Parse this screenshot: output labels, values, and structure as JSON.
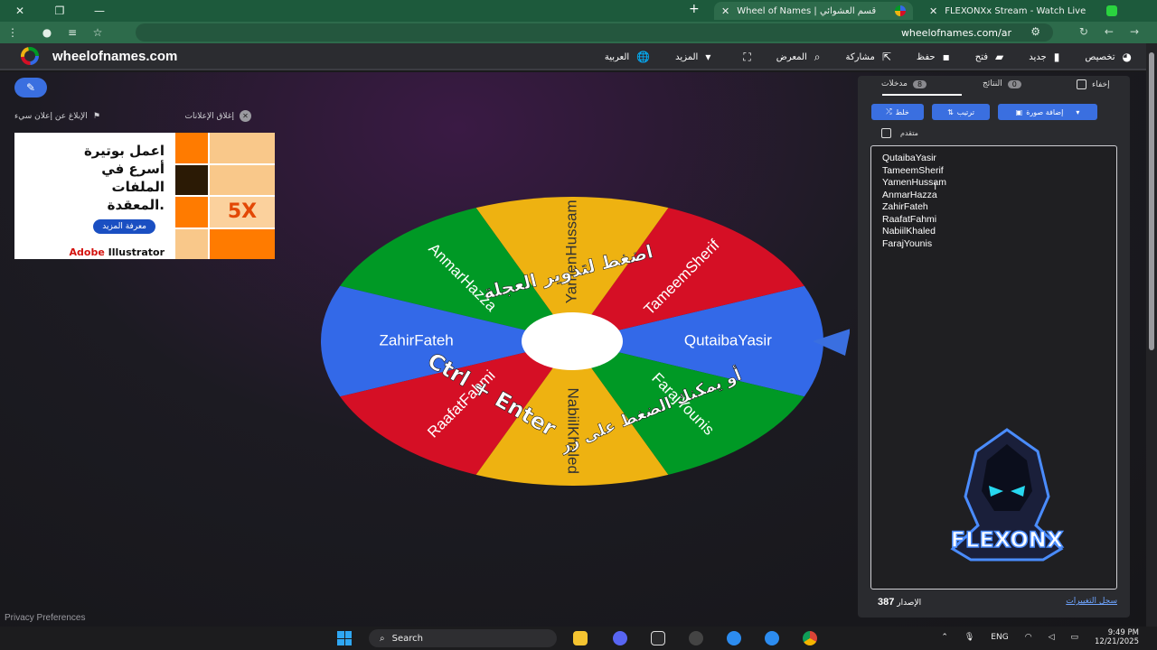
{
  "browser": {
    "tabs": [
      {
        "title": "Wheel of Names | قسم العشوائي",
        "active": true
      },
      {
        "title": "FLEXONXx Stream - Watch Live",
        "active": false
      }
    ],
    "new_tab": "+",
    "url": "wheelofnames.com/ar"
  },
  "header": {
    "logo_text": "wheelofnames.com",
    "menu": [
      {
        "label": "العربية",
        "icon": "globe-icon"
      },
      {
        "label": "المزيد",
        "icon": "dropdown-icon"
      },
      {
        "label": "",
        "icon": "fullscreen-icon"
      },
      {
        "label": "المعرض",
        "icon": "search-icon"
      },
      {
        "label": "مشاركة",
        "icon": "share-icon"
      },
      {
        "label": "حفظ",
        "icon": "save-icon"
      },
      {
        "label": "فتح",
        "icon": "folder-icon"
      },
      {
        "label": "جديد",
        "icon": "file-icon"
      },
      {
        "label": "تخصيص",
        "icon": "palette-icon"
      }
    ]
  },
  "ads": {
    "close_ads": "إغلاق الإعلانات",
    "report_ad": "الإبلاغ عن إعلان سيء",
    "title_lines": [
      "اعمل بوتيرة",
      "أسرع في",
      "الملفات",
      "المعقدة."
    ],
    "cta": "معرفة المزيد",
    "brand_a": "Adobe",
    "brand_b": "Illustrator",
    "badge": "5X"
  },
  "wheel": {
    "segments": [
      {
        "name": "QutaibaYasir",
        "color": "#3369e8"
      },
      {
        "name": "TameemSherif",
        "color": "#d50f25"
      },
      {
        "name": "YamenHussam",
        "color": "#eeb211"
      },
      {
        "name": "AnmarHazza",
        "color": "#009925"
      },
      {
        "name": "ZahirFateh",
        "color": "#3369e8"
      },
      {
        "name": "RaafatFahmi",
        "color": "#d50f25"
      },
      {
        "name": "NabiilKhaled",
        "color": "#eeb211"
      },
      {
        "name": "FarajYounis",
        "color": "#009925"
      }
    ],
    "hint_top": "اضغط لتدوير العجلة",
    "hint_mid": "أو يمكنك الضغط على زر",
    "hint_key": "Ctrl + Enter"
  },
  "panel": {
    "tab_entries": "مدخلات",
    "entries_count": "8",
    "tab_results": "النتائج",
    "results_count": "0",
    "hide_label": "إخفاء",
    "shuffle": "خلط",
    "sort": "ترتيب",
    "add_image": "إضافة صورة",
    "advanced": "متقدم",
    "entries": [
      "QutaibaYasir",
      "TameemSherif",
      "YamenHussam",
      "AnmarHazza",
      "ZahirFateh",
      "RaafatFahmi",
      "NabiilKhaled",
      "FarajYounis"
    ],
    "version_label": "الإصدار",
    "version": "387",
    "changelog": "سجل التغييرات"
  },
  "footer": {
    "privacy": "Privacy Preferences"
  },
  "watermark": {
    "text": "FLEXONX"
  },
  "taskbar": {
    "search": "Search",
    "lang": "ENG",
    "time": "9:49 PM",
    "date": "12/21/2025"
  }
}
